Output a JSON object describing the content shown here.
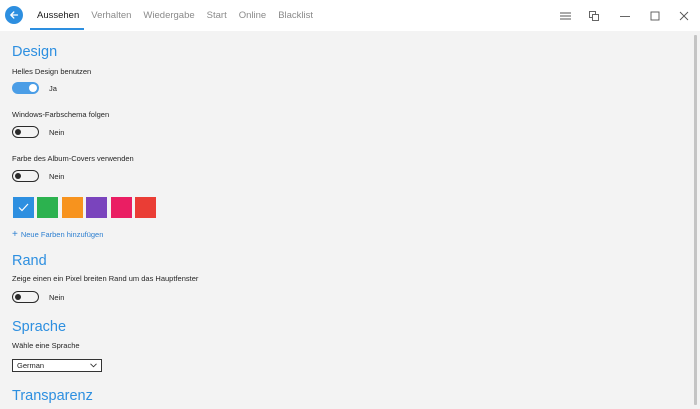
{
  "tabs": [
    {
      "label": "Aussehen"
    },
    {
      "label": "Verhalten"
    },
    {
      "label": "Wiedergabe"
    },
    {
      "label": "Start"
    },
    {
      "label": "Online"
    },
    {
      "label": "Blacklist"
    }
  ],
  "design": {
    "title": "Design",
    "light_label": "Helles Design benutzen",
    "light_value": "Ja",
    "windows_label": "Windows-Farbschema folgen",
    "windows_value": "Nein",
    "album_label": "Farbe des Album-Covers verwenden",
    "album_value": "Nein",
    "swatch_colors": [
      "#2d8fe0",
      "#2cb24f",
      "#f7931e",
      "#7a44bd",
      "#ea1e63",
      "#ea3d35"
    ],
    "selected_swatch": 0,
    "add_colors_label": "Neue Farben hinzufügen"
  },
  "rand": {
    "title": "Rand",
    "label": "Zeige einen ein Pixel breiten Rand um das Hauptfenster",
    "value": "Nein"
  },
  "sprache": {
    "title": "Sprache",
    "label": "Wähle eine Sprache",
    "selected": "German"
  },
  "transparenz": {
    "title": "Transparenz"
  },
  "accent_color": "#2d8fe0"
}
